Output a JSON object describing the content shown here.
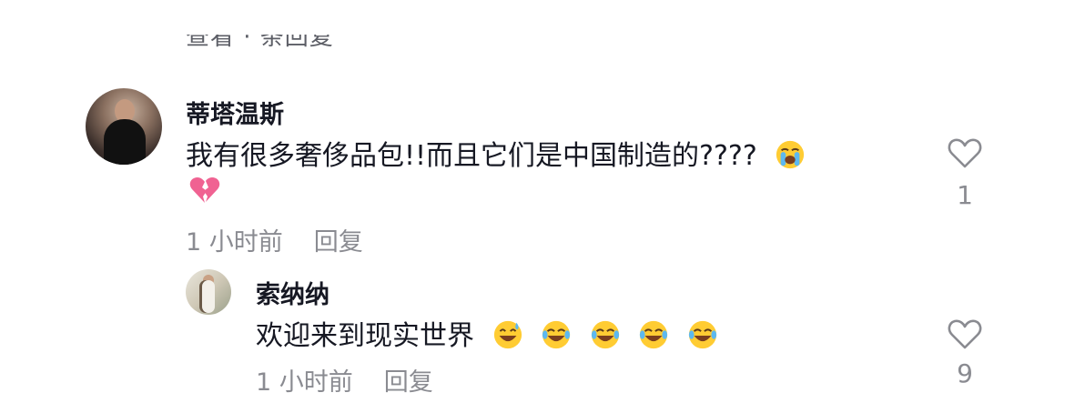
{
  "header": {
    "partial_text": "查看 · 条回复"
  },
  "comment": {
    "username": "蒂塔温斯",
    "text": "我有很多奢侈品包!!而且它们是中国制造的????",
    "emoji_after_text": "loudly-crying-face",
    "emoji_second_line": "broken-heart",
    "time": "1 小时前",
    "reply_label": "回复",
    "like_count": "1"
  },
  "reply": {
    "username": "索纳纳",
    "text": "欢迎来到现实世界",
    "emojis": [
      "grinning-face-with-sweat",
      "face-with-tears-of-joy",
      "face-with-tears-of-joy",
      "face-with-tears-of-joy",
      "face-with-tears-of-joy"
    ],
    "time": "1 小时前",
    "reply_label": "回复",
    "like_count": "9"
  },
  "colors": {
    "text": "#161823",
    "muted": "#8a8b91",
    "heart_outline": "#8a8b91",
    "emoji_yellow": "#ffcc33",
    "broken_heart": "#f06292"
  }
}
